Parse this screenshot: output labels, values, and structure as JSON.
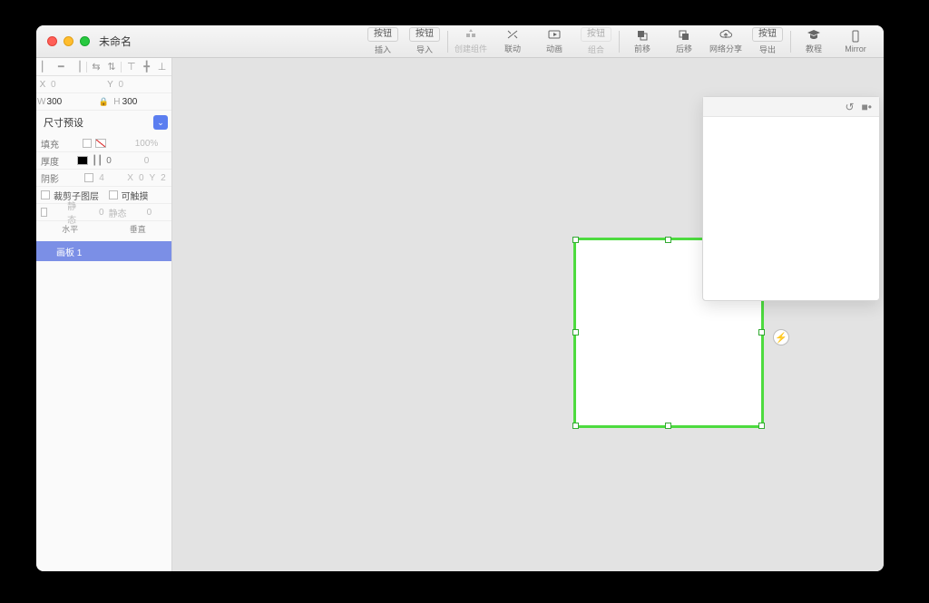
{
  "window": {
    "title": "未命名"
  },
  "toolbar": {
    "insert": {
      "top": "按钮",
      "label": "插入"
    },
    "import": {
      "top": "按钮",
      "label": "导入"
    },
    "makecomp": {
      "label": "创建组件"
    },
    "link": {
      "label": "联动"
    },
    "animate": {
      "label": "动画"
    },
    "group": {
      "top": "按钮",
      "label": "组合"
    },
    "forward": {
      "label": "前移"
    },
    "backward": {
      "label": "后移"
    },
    "share": {
      "label": "网络分享"
    },
    "export": {
      "top": "按钮",
      "label": "导出"
    },
    "tutorial": {
      "label": "教程"
    },
    "mirror": {
      "label": "Mirror"
    }
  },
  "inspector": {
    "x_label": "X",
    "x": "0",
    "y_label": "Y",
    "y": "0",
    "w_label": "W",
    "w": "300",
    "h_label": "H",
    "h": "300",
    "preset": "尺寸预设",
    "fill": {
      "label": "填充",
      "value": "100%"
    },
    "border": {
      "label": "厚度",
      "dash": "0",
      "value": "0"
    },
    "shadow": {
      "label": "阴影",
      "blur": "4",
      "sx_label": "X",
      "sx": "0",
      "sy_label": "Y",
      "sy": "2"
    },
    "clip": "裁剪子图层",
    "touch": "可触摸",
    "staticA": "静态",
    "staticA_v": "0",
    "staticB": "静态",
    "staticB_v": "0",
    "axis_h": "水平",
    "axis_v": "垂直"
  },
  "layers": {
    "item1": "画板 1"
  },
  "action_glyph": "⚡"
}
